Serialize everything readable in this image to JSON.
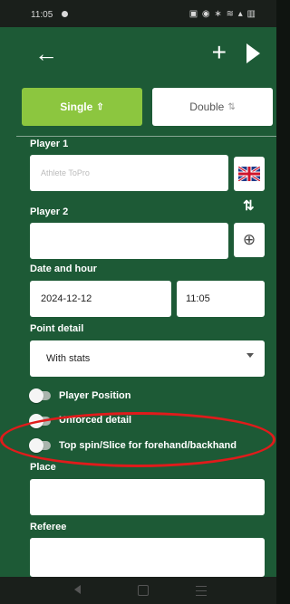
{
  "status": {
    "time": "11:05",
    "icons": "▣ ◉ ∗ ≋ ▴ ▥"
  },
  "appbar": {
    "back_glyph": "←",
    "plus_glyph": "+"
  },
  "tabs": {
    "single": "Single",
    "double": "Double",
    "single_icon": "⇧",
    "double_icon": "⇅"
  },
  "player1": {
    "label": "Player 1",
    "placeholder": "Athlete ToPro"
  },
  "player2": {
    "label": "Player 2",
    "value": "",
    "swap_glyph": "⇅",
    "globe_glyph": "⊕"
  },
  "date_hour": {
    "label": "Date and hour",
    "date": "2024-12-12",
    "time": "11:05"
  },
  "point_detail": {
    "label": "Point detail",
    "value": "With stats"
  },
  "toggles": {
    "player_position": "Player Position",
    "unforced_detail": "Unforced detail",
    "topspin": "Top spin/Slice for forehand/backhand"
  },
  "place": {
    "label": "Place",
    "value": ""
  },
  "referee": {
    "label": "Referee",
    "value": ""
  },
  "colors": {
    "primary": "#1d5a36",
    "accent": "#8cc63f",
    "highlight": "#e01b1b"
  }
}
